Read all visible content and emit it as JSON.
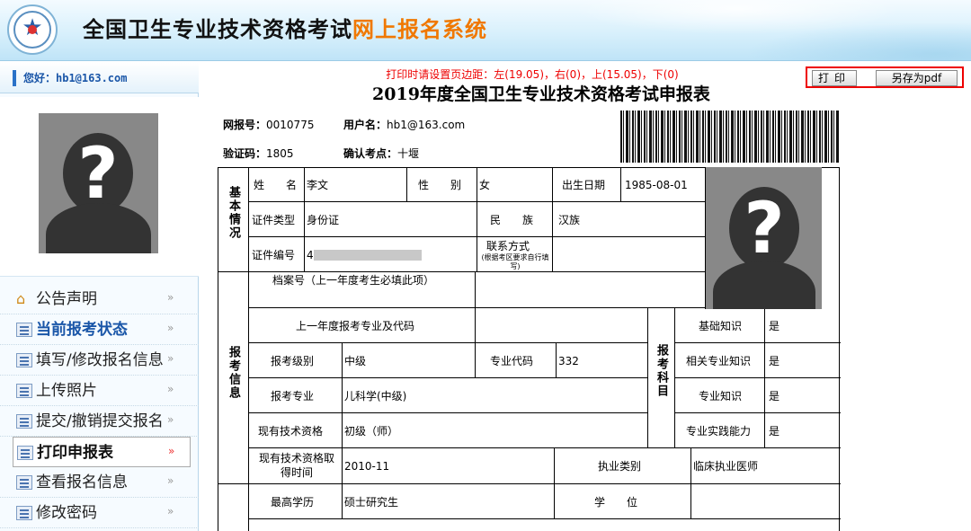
{
  "header": {
    "title_main": "全国卫生专业技术资格考试",
    "title_accent": "网上报名系统",
    "accent_color": "#f07800"
  },
  "sidebar": {
    "greeting": "您好：hb1@163.com",
    "photo_placeholder": "?",
    "items": [
      {
        "label": "公告声明",
        "icon": "home-icon"
      },
      {
        "label": "当前报考状态",
        "icon": "document-icon"
      },
      {
        "label": "填写/修改报名信息",
        "icon": "document-icon"
      },
      {
        "label": "上传照片",
        "icon": "document-icon"
      },
      {
        "label": "提交/撤销提交报名",
        "icon": "document-icon"
      },
      {
        "label": "打印申报表",
        "icon": "document-icon"
      },
      {
        "label": "查看报名信息",
        "icon": "document-icon"
      },
      {
        "label": "修改密码",
        "icon": "document-icon"
      }
    ],
    "arrow": "»"
  },
  "main": {
    "notice": "打印时请设置页边距：左(19.05)，右(0)，上(15.05)，下(0)",
    "print_button": "打印",
    "save_pdf_button": "另存为pdf",
    "form_title": "2019年度全国卫生专业技术资格考试申报表",
    "meta": {
      "reg_no_label": "网报号：",
      "reg_no": "0010775",
      "user_label": "用户名：",
      "user": "hb1@163.com",
      "verify_label": "验证码：",
      "verify": "1805",
      "site_label": "确认考点：",
      "site": "十堰"
    },
    "table": {
      "sec_basic": "基本情况",
      "sec_apply": "报考信息",
      "sec_subject": "报考科目",
      "name_label": "姓　　名",
      "name": "李文",
      "gender_label": "性　　别",
      "gender": "女",
      "birth_label": "出生日期",
      "birth": "1985-08-01",
      "id_type_label": "证件类型",
      "id_type": "身份证",
      "ethnic_label": "民　　族",
      "ethnic": "汉族",
      "id_no_label": "证件编号",
      "id_no_prefix": "4",
      "contact_label": "联系方式",
      "contact_note": "(根据考区要求自行填写)",
      "archive_label": "档案号（上一年度考生必填此项）",
      "last_year_label": "上一年度报考专业及代码",
      "level_label": "报考级别",
      "level": "中级",
      "code_label": "专业代码",
      "code": "332",
      "major_label": "报考专业",
      "major": "儿科学(中级)",
      "cur_qual_label": "现有技术资格",
      "cur_qual": "初级（师）",
      "qual_time_label": "现有技术资格取得时间",
      "qual_time": "2010-11",
      "practice_type_label": "执业类别",
      "practice_type": "临床执业医师",
      "edu_label": "最高学历",
      "edu": "硕士研究生",
      "degree_label": "学　　位",
      "subjects": [
        {
          "label": "基础知识",
          "value": "是"
        },
        {
          "label": "相关专业知识",
          "value": "是"
        },
        {
          "label": "专业知识",
          "value": "是"
        },
        {
          "label": "专业实践能力",
          "value": "是"
        }
      ]
    }
  }
}
